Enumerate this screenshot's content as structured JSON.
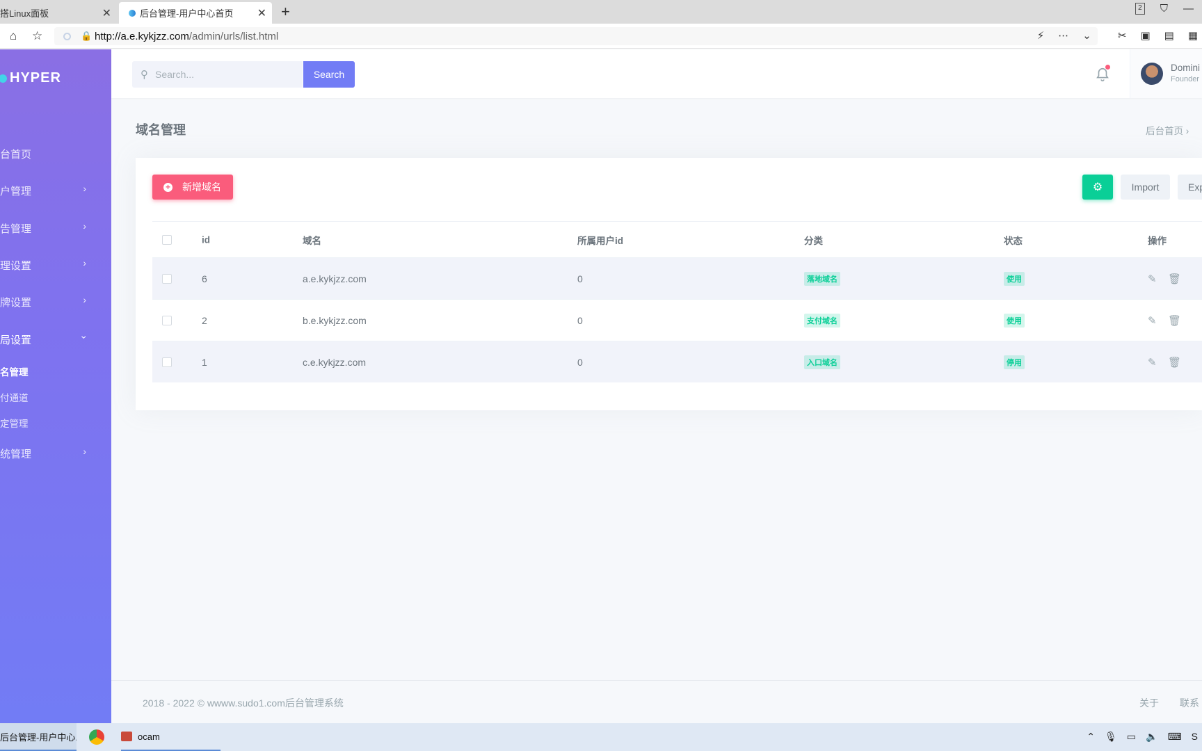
{
  "browser": {
    "tabs": [
      {
        "title": "搭Linux面板"
      },
      {
        "title": "后台管理-用户中心首页"
      }
    ],
    "url_host": "http://a.e.kykjzz.com",
    "url_path": "/admin/urls/list.html",
    "tab_count_badge": "2"
  },
  "sidebar": {
    "logo_text": "HYPER",
    "items": [
      {
        "label": "台首页"
      },
      {
        "label": "户管理"
      },
      {
        "label": "告管理"
      },
      {
        "label": "理设置"
      },
      {
        "label": "牌设置"
      },
      {
        "label": "局设置"
      }
    ],
    "subitems": [
      {
        "label": "名管理"
      },
      {
        "label": "付通道"
      },
      {
        "label": "定管理"
      }
    ],
    "last_item": {
      "label": "统管理"
    }
  },
  "topbar": {
    "search_placeholder": "Search...",
    "search_button": "Search",
    "user_name": "Domini",
    "user_role": "Founder"
  },
  "page": {
    "title": "域名管理",
    "breadcrumb": "后台首页"
  },
  "toolbar": {
    "add_label": "新增域名",
    "import_label": "Import",
    "export_label": "Exp"
  },
  "table": {
    "headers": [
      "id",
      "域名",
      "所属用户id",
      "分类",
      "状态",
      "操作"
    ],
    "rows": [
      {
        "id": "6",
        "domain": "a.e.kykjzz.com",
        "user_id": "0",
        "category": "落地域名",
        "status": "使用"
      },
      {
        "id": "2",
        "domain": "b.e.kykjzz.com",
        "user_id": "0",
        "category": "支付域名",
        "status": "使用"
      },
      {
        "id": "1",
        "domain": "c.e.kykjzz.com",
        "user_id": "0",
        "category": "入口域名",
        "status": "停用"
      }
    ]
  },
  "footer": {
    "copyright": "2018 - 2022 © wwww.sudo1.com后台管理系统",
    "links": [
      "关于",
      "联系"
    ]
  },
  "taskbar": {
    "items": [
      {
        "label": "后台管理-用户中心..."
      },
      {
        "label": "ocam"
      }
    ]
  },
  "colors": {
    "primary": "#727cf5",
    "danger": "#fa5c7c",
    "success": "#0acf97"
  }
}
